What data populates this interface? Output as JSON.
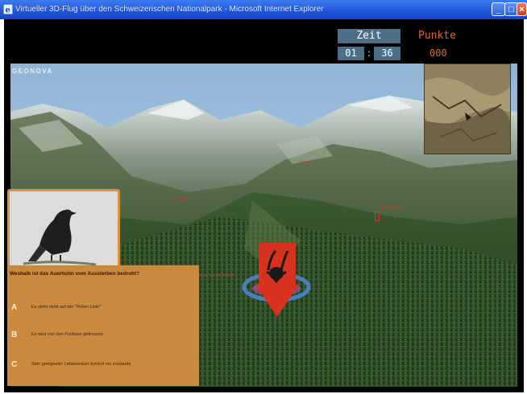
{
  "window": {
    "title": "Virtueller 3D-Flug über den Schweizerischen Nationalpark - Microsoft Internet Explorer",
    "min_symbol": "_",
    "max_symbol": "□",
    "close_symbol": "×"
  },
  "hud": {
    "zeit_label": "Zeit",
    "time_minutes": "01",
    "time_separator": ":",
    "time_seconds": "36",
    "punkte_label": "Punkte",
    "punkte_value": "000"
  },
  "scene": {
    "logo": "GEONOVA",
    "place_labels": [
      "Fuorn",
      "Il Fuorn",
      "Alp Buffalora",
      "Fuorcla Val dal Botsch"
    ],
    "icons": {
      "sign": "ibex-warning-sign-icon",
      "minimap": "overview-map",
      "bird": "capercaillie-photo"
    },
    "colors": {
      "accent_orange": "#e0692a",
      "hud_blue": "#4d6f86",
      "quiz_panel": "#c98a3f",
      "sign_red": "#d8321f"
    }
  },
  "quiz": {
    "question": "Weshalb ist das Auerhuhn vom Aussterben bedroht?",
    "answers": [
      {
        "letter": "A",
        "text": "Es steht nicht auf der \"Roten Liste\""
      },
      {
        "letter": "B",
        "text": "Es wird von den Füchsen gefressen"
      },
      {
        "letter": "C",
        "text": "Sein geeigneter Lebensraum kommt nie zustande"
      }
    ]
  }
}
